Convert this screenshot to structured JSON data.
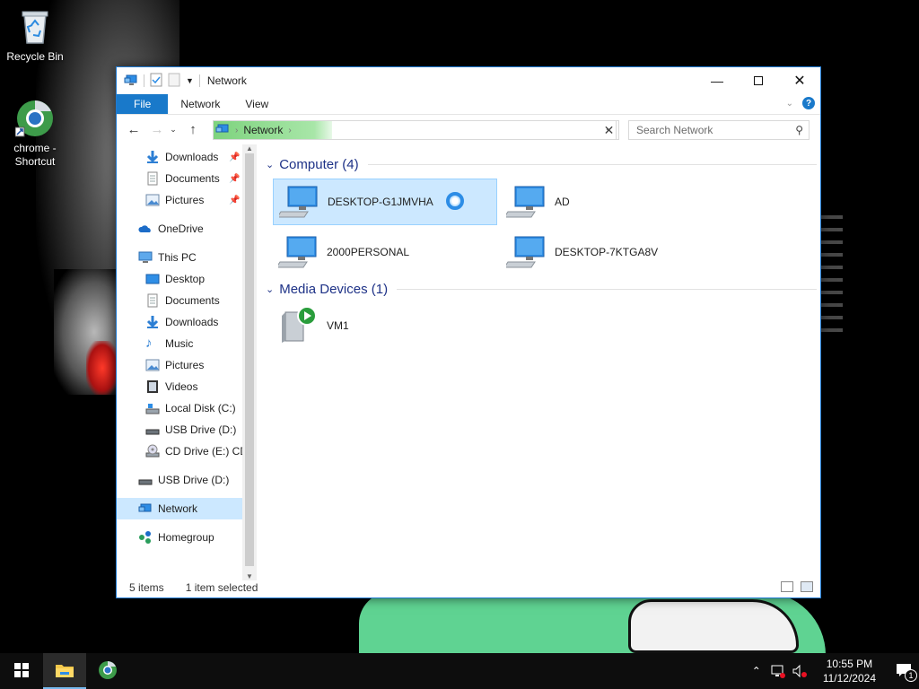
{
  "desktop": {
    "icons": [
      {
        "label": "Recycle Bin",
        "icon": "recycle-bin-icon"
      },
      {
        "label": "chrome - Shortcut",
        "icon": "chrome-icon"
      }
    ]
  },
  "window": {
    "title": "Network",
    "ribbon_tabs": [
      "File",
      "Network",
      "View"
    ],
    "address": {
      "location": "Network"
    },
    "search": {
      "placeholder": "Search Network"
    }
  },
  "navpane": {
    "items": [
      {
        "label": "Downloads",
        "icon": "download-arrow-icon",
        "pinned": true
      },
      {
        "label": "Documents",
        "icon": "documents-icon",
        "pinned": true
      },
      {
        "label": "Pictures",
        "icon": "pictures-icon",
        "pinned": true
      },
      {
        "label": "OneDrive",
        "icon": "onedrive-cloud-icon"
      },
      {
        "label": "This PC",
        "icon": "this-pc-icon"
      },
      {
        "label": "Desktop",
        "icon": "desktop-folder-icon"
      },
      {
        "label": "Documents",
        "icon": "documents-icon"
      },
      {
        "label": "Downloads",
        "icon": "download-arrow-icon"
      },
      {
        "label": "Music",
        "icon": "music-note-icon"
      },
      {
        "label": "Pictures",
        "icon": "pictures-icon"
      },
      {
        "label": "Videos",
        "icon": "videos-icon"
      },
      {
        "label": "Local Disk (C:)",
        "icon": "local-disk-icon"
      },
      {
        "label": "USB Drive (D:)",
        "icon": "usb-drive-icon"
      },
      {
        "label": "CD Drive (E:) CD",
        "icon": "cd-drive-icon"
      },
      {
        "label": "USB Drive (D:)",
        "icon": "usb-drive-icon"
      },
      {
        "label": "Network",
        "icon": "network-icon",
        "selected": true
      },
      {
        "label": "Homegroup",
        "icon": "homegroup-icon"
      }
    ]
  },
  "content": {
    "groups": [
      {
        "header": "Computer (4)",
        "items": [
          {
            "name": "DESKTOP-G1JMVHA",
            "selected": true,
            "loading": true
          },
          {
            "name": "AD"
          },
          {
            "name": "2000PERSONAL"
          },
          {
            "name": "DESKTOP-7KTGA8V"
          }
        ]
      },
      {
        "header": "Media Devices (1)",
        "items": [
          {
            "name": "VM1"
          }
        ]
      }
    ]
  },
  "status": {
    "items_count": "5 items",
    "selection": "1 item selected"
  },
  "taskbar": {
    "time": "10:55 PM",
    "date": "11/12/2024",
    "notification_count": "1"
  },
  "colors": {
    "accent": "#1979ca",
    "selection": "#cce8ff",
    "group_header": "#1e3287"
  }
}
